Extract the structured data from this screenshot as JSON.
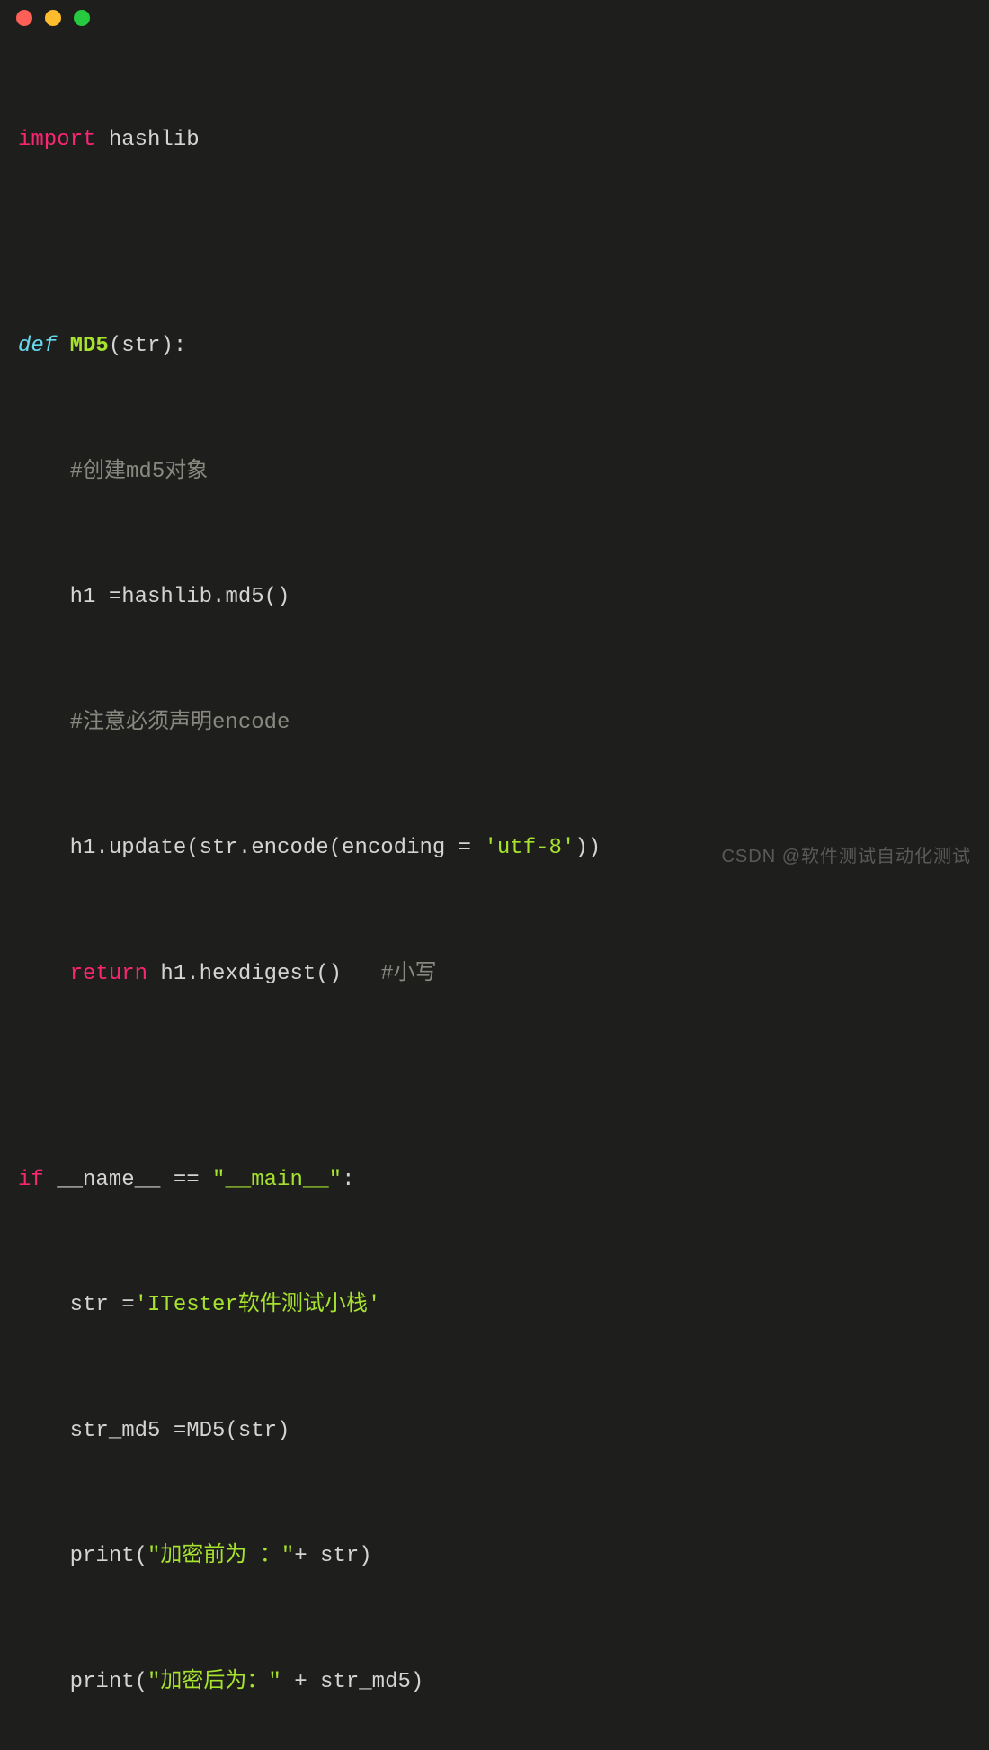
{
  "code": {
    "line1_import": "import",
    "line1_module": " hashlib",
    "line3_def": "def",
    "line3_fn": " MD5",
    "line3_params": "(str):",
    "line4_comment": "    #创建md5对象",
    "line5": "    h1 =hashlib.md5()",
    "line6_comment": "    #注意必须声明encode",
    "line7_a": "    h1.update(str.encode(encoding = ",
    "line7_str": "'utf-8'",
    "line7_b": "))",
    "line8_ret": "    return",
    "line8_rest": " h1.hexdigest()   ",
    "line8_comment": "#小写",
    "line10_if": "if",
    "line10_a": " __name__ == ",
    "line10_str": "\"__main__\"",
    "line10_b": ":",
    "line11_a": "    str =",
    "line11_str": "'ITester软件测试小栈'",
    "line12": "    str_md5 =MD5(str)",
    "line13_a": "    print(",
    "line13_str": "\"加密前为 ：\"",
    "line13_b": "+ str)",
    "line14_a": "    print(",
    "line14_str": "\"加密后为：\"",
    "line14_b": " + str_md5)"
  },
  "watermark": "CSDN @软件测试自动化测试"
}
